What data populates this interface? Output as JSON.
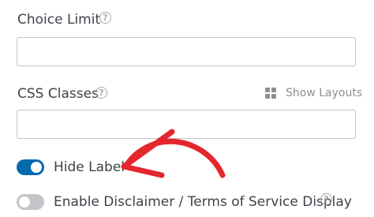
{
  "fields": {
    "choice_limit": {
      "label": "Choice Limit",
      "value": ""
    },
    "css_classes": {
      "label": "CSS Classes",
      "value": ""
    }
  },
  "show_layouts": {
    "label": "Show Layouts",
    "icon": "grid-icon"
  },
  "toggles": {
    "hide_label": {
      "label": "Hide Label",
      "checked": true
    },
    "disclaimer": {
      "label": "Enable Disclaimer / Terms of Service Display",
      "checked": false
    }
  },
  "help_icon_text": "?",
  "colors": {
    "toggle_on": "#036aab",
    "toggle_off": "#c3c4c7",
    "annotation_arrow": "#e4272c",
    "text": "#3c434a",
    "muted": "#a7aaad"
  }
}
